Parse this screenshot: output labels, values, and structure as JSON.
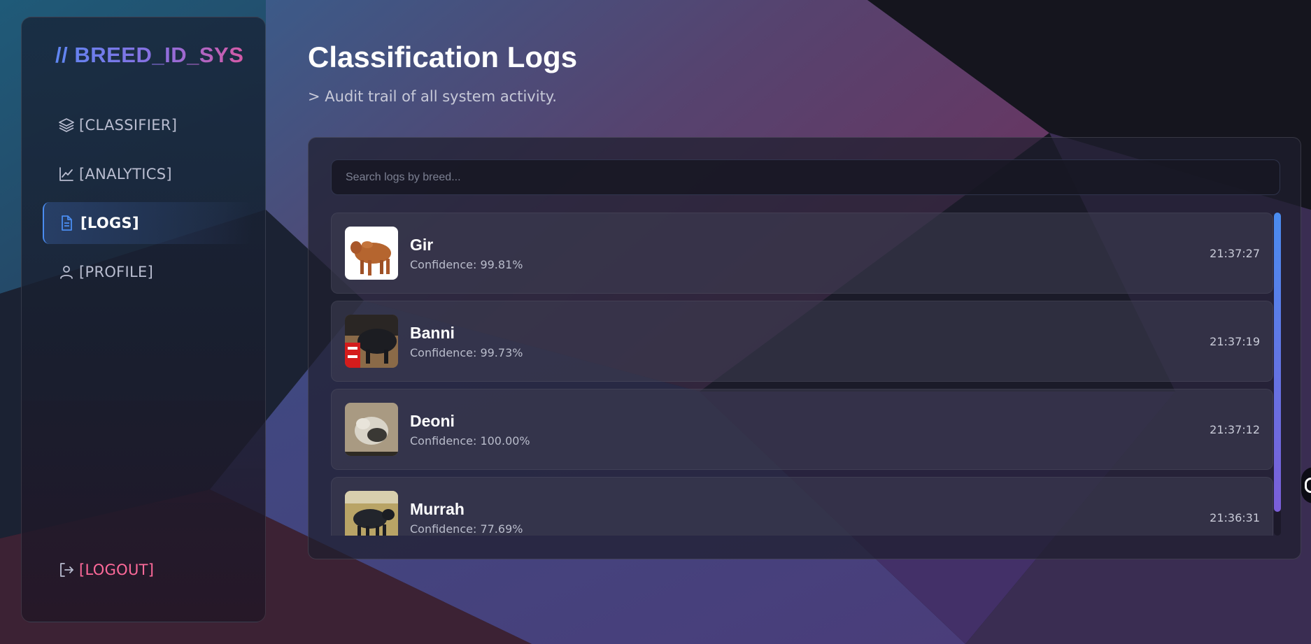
{
  "sidebar": {
    "brand": "// BREED_ID_SYS",
    "items": [
      {
        "label": "[CLASSIFIER]",
        "icon": "layers-icon"
      },
      {
        "label": "[ANALYTICS]",
        "icon": "line-chart-icon"
      },
      {
        "label": "[LOGS]",
        "icon": "document-icon",
        "active": true
      },
      {
        "label": "[PROFILE]",
        "icon": "user-icon"
      }
    ],
    "logout": {
      "label": "[LOGOUT]",
      "icon": "logout-icon"
    }
  },
  "main": {
    "title": "Classification Logs",
    "subtitle": "> Audit trail of all system activity.",
    "search": {
      "placeholder": "Search logs by breed...",
      "value": ""
    },
    "logs": [
      {
        "breed": "Gir",
        "confidence": "Confidence: 99.81%",
        "time": "21:37:27"
      },
      {
        "breed": "Banni",
        "confidence": "Confidence: 99.73%",
        "time": "21:37:19"
      },
      {
        "breed": "Deoni",
        "confidence": "Confidence: 100.00%",
        "time": "21:37:12"
      },
      {
        "breed": "Murrah",
        "confidence": "Confidence: 77.69%",
        "time": "21:36:31"
      }
    ]
  },
  "colors": {
    "accent_blue": "#4a8cf0",
    "accent_purple": "#7b5ed8",
    "logout_pink": "#ff6a9a"
  }
}
